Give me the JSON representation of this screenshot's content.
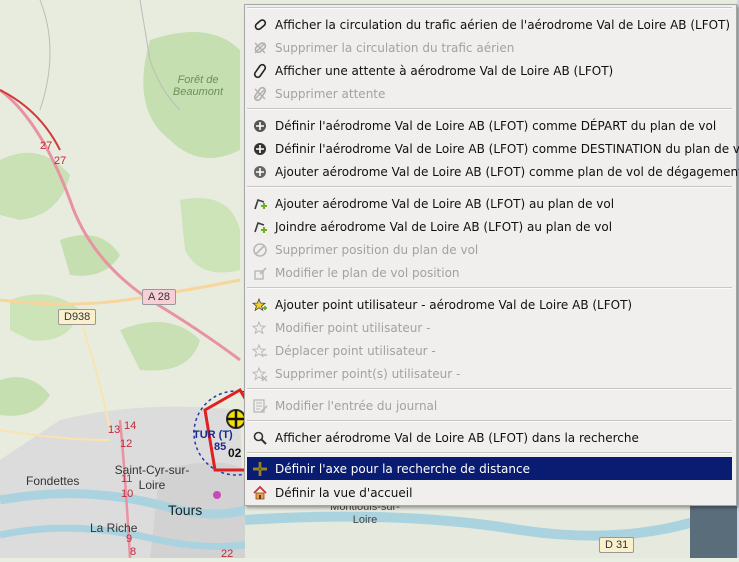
{
  "map": {
    "labels": {
      "forest": "Forêt de Beaumont",
      "a28": "A 28",
      "d938": "D938",
      "d31": "D 31",
      "saint_cyr": "Saint-Cyr-sur-Loire",
      "fondettes": "Fondettes",
      "tours": "Tours",
      "la_riche": "La Riche",
      "montlouis": "Montlouis-sur-Loire",
      "tur": "TUR (T)",
      "freq": "85",
      "rwy": "02"
    },
    "road_numbers": [
      "27",
      "27",
      "13",
      "14",
      "12",
      "11",
      "10",
      "9",
      "8",
      "22"
    ]
  },
  "menu": {
    "items": [
      {
        "label": "Afficher la circulation du trafic aérien de l'aérodrome Val de Loire AB (LFOT)",
        "icon": "traffic-pattern-icon",
        "disabled": false
      },
      {
        "label": "Supprimer la circulation du trafic aérien",
        "icon": "remove-traffic-pattern-icon",
        "disabled": true
      },
      {
        "label": "Afficher une attente à aérodrome Val de Loire AB (LFOT)",
        "icon": "holding-icon",
        "disabled": false
      },
      {
        "label": "Supprimer attente",
        "icon": "remove-holding-icon",
        "disabled": true
      },
      {
        "label": "Définir l'aérodrome Val de Loire AB (LFOT) comme DÉPART du plan de vol",
        "icon": "departure-icon",
        "disabled": false
      },
      {
        "label": "Définir l'aérodrome Val de Loire AB (LFOT) comme DESTINATION du plan de vol",
        "icon": "destination-icon",
        "disabled": false
      },
      {
        "label": "Ajouter aérodrome Val de Loire AB (LFOT) comme plan de vol de dégagement",
        "icon": "alternate-icon",
        "disabled": false
      },
      {
        "label": "Ajouter aérodrome Val de Loire AB (LFOT) au plan de vol",
        "icon": "add-to-flightplan-icon",
        "disabled": false
      },
      {
        "label": "Joindre aérodrome Val de Loire AB (LFOT) au plan de vol",
        "icon": "append-to-flightplan-icon",
        "disabled": false
      },
      {
        "label": "Supprimer position du plan de vol",
        "icon": "remove-position-icon",
        "disabled": true
      },
      {
        "label": "Modifier le plan de vol position",
        "icon": "edit-position-icon",
        "disabled": true
      },
      {
        "label": "Ajouter point utilisateur - aérodrome Val de Loire AB (LFOT)",
        "icon": "add-userpoint-icon",
        "disabled": false
      },
      {
        "label": "Modifier point utilisateur -",
        "icon": "edit-userpoint-icon",
        "disabled": true
      },
      {
        "label": "Déplacer point utilisateur -",
        "icon": "move-userpoint-icon",
        "disabled": true
      },
      {
        "label": "Supprimer point(s) utilisateur -",
        "icon": "delete-userpoint-icon",
        "disabled": true
      },
      {
        "label": "Modifier l'entrée du journal",
        "icon": "edit-logbook-icon",
        "disabled": true
      },
      {
        "label": "Afficher aérodrome Val de Loire AB (LFOT) dans la recherche",
        "icon": "search-icon",
        "disabled": false
      },
      {
        "label": "Définir l'axe pour la recherche de distance",
        "icon": "crosshair-icon",
        "disabled": false,
        "selected": true
      },
      {
        "label": "Définir la vue d'accueil",
        "icon": "home-icon",
        "disabled": false
      }
    ]
  }
}
